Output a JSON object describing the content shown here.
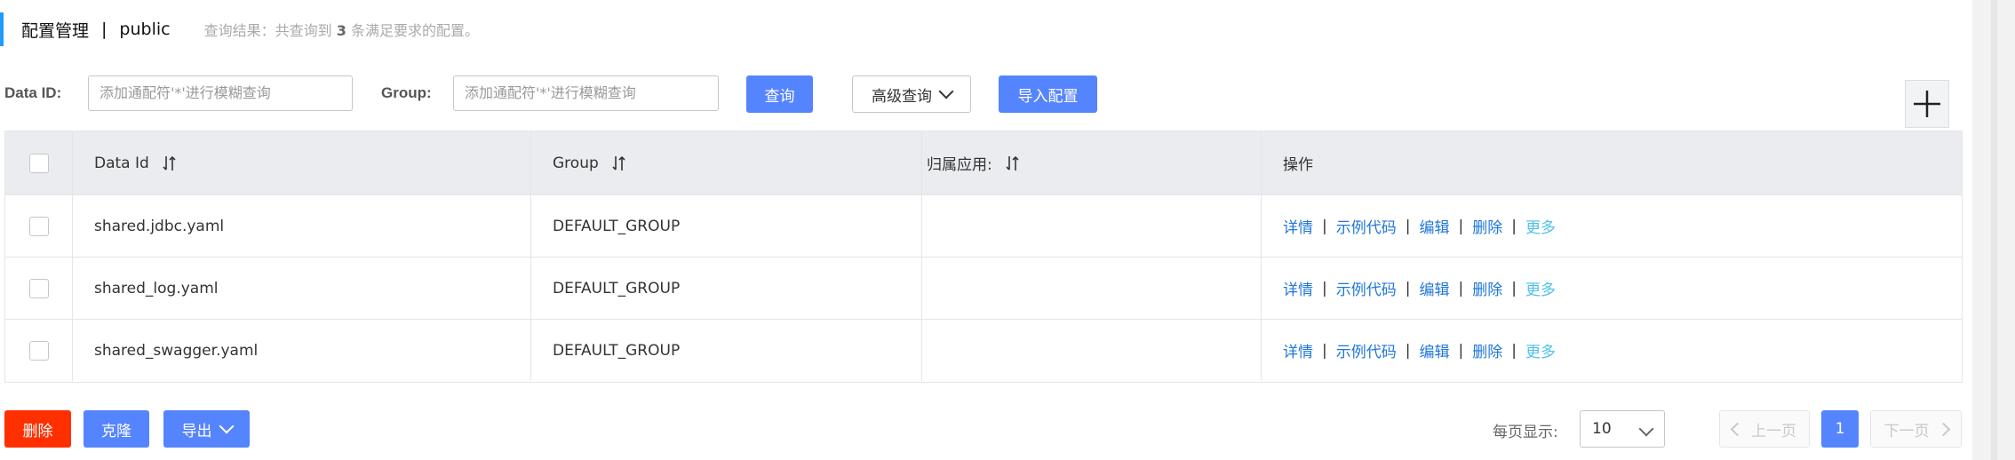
{
  "header": {
    "title": "配置管理",
    "separator": "|",
    "namespace": "public",
    "result_prefix": "查询结果：共查询到",
    "result_count": "3",
    "result_suffix": "条满足要求的配置。"
  },
  "filters": {
    "data_id_label": "Data ID:",
    "data_id_placeholder": "添加通配符'*'进行模糊查询",
    "group_label": "Group:",
    "group_placeholder": "添加通配符'*'进行模糊查询",
    "query_button": "查询",
    "advanced_query_button": "高级查询",
    "import_button": "导入配置"
  },
  "table": {
    "columns": [
      "Data Id",
      "Group",
      "归属应用:",
      "操作"
    ],
    "rows": [
      {
        "data_id": "shared.jdbc.yaml",
        "group": "DEFAULT_GROUP",
        "app": ""
      },
      {
        "data_id": "shared_log.yaml",
        "group": "DEFAULT_GROUP",
        "app": ""
      },
      {
        "data_id": "shared_swagger.yaml",
        "group": "DEFAULT_GROUP",
        "app": ""
      }
    ],
    "actions": {
      "detail": "详情",
      "sample_code": "示例代码",
      "edit": "编辑",
      "delete": "删除",
      "more": "更多",
      "separator": "|"
    }
  },
  "footer": {
    "delete_button": "删除",
    "clone_button": "克隆",
    "export_button": "导出",
    "page_size_label": "每页显示:",
    "page_size_value": "10",
    "prev_page": "上一页",
    "current_page": "1",
    "next_page": "下一页"
  },
  "colors": {
    "primary": "#5584ff",
    "danger": "#ff3000",
    "link": "#2077da",
    "more_link": "#4fc1e9",
    "title_accent": "#209bfa"
  },
  "icons": [
    "plus-icon",
    "sort-icon",
    "chevron-down-icon",
    "chevron-left-icon",
    "chevron-right-icon"
  ]
}
